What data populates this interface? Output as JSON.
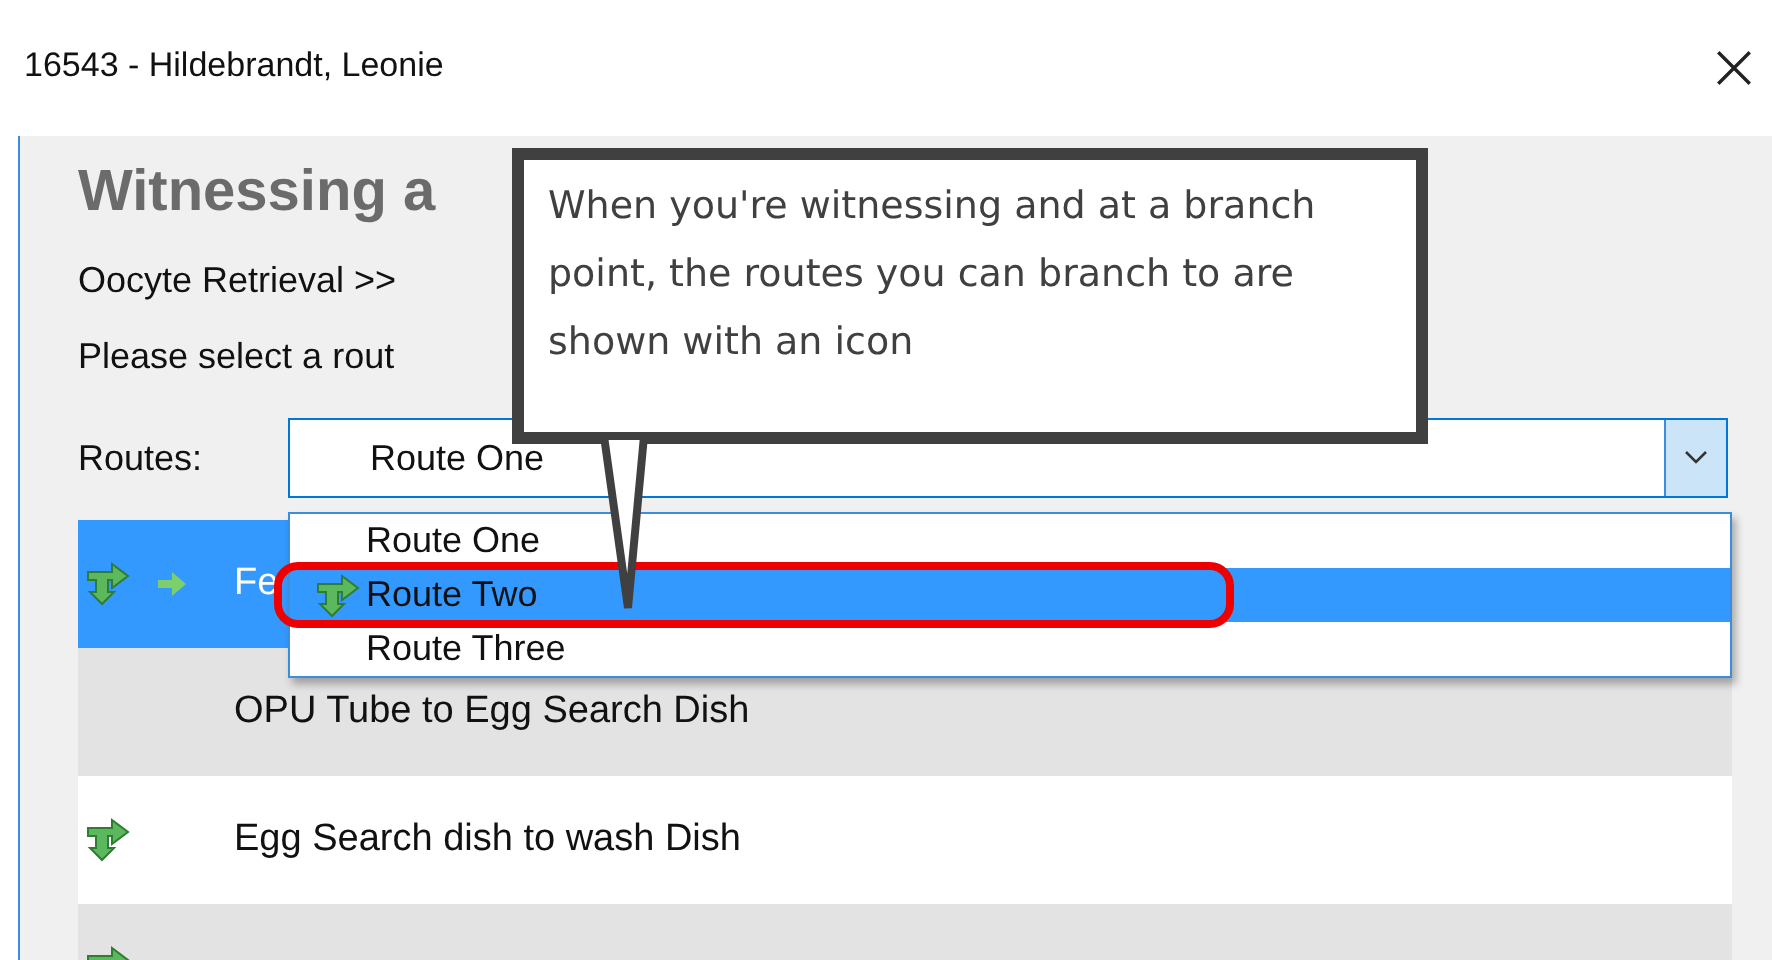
{
  "window": {
    "title": "16543 - Hildebrandt, Leonie"
  },
  "heading": "Witnessing a",
  "breadcrumb": "Oocyte Retrieval >>",
  "prompt": "Please select a rout",
  "routes": {
    "label": "Routes:",
    "value": "Route One",
    "expanded": true,
    "options": [
      {
        "label": "Route One",
        "highlighted": false,
        "branch": false
      },
      {
        "label": "Route Two",
        "highlighted": true,
        "branch": true
      },
      {
        "label": "Route Three",
        "highlighted": false,
        "branch": false
      }
    ]
  },
  "steps": [
    {
      "label": "Fe",
      "selected": true,
      "branch": true,
      "current": true
    },
    {
      "label": "OPU Tube to Egg Search Dish",
      "selected": false,
      "branch": false,
      "current": false
    },
    {
      "label": "Egg Search dish to wash Dish",
      "selected": false,
      "branch": true,
      "current": false
    },
    {
      "selected": false,
      "branch": true,
      "current": false
    }
  ],
  "callout": {
    "text": "When you're witnessing and at a branch point, the routes you can branch to are shown with an icon"
  }
}
